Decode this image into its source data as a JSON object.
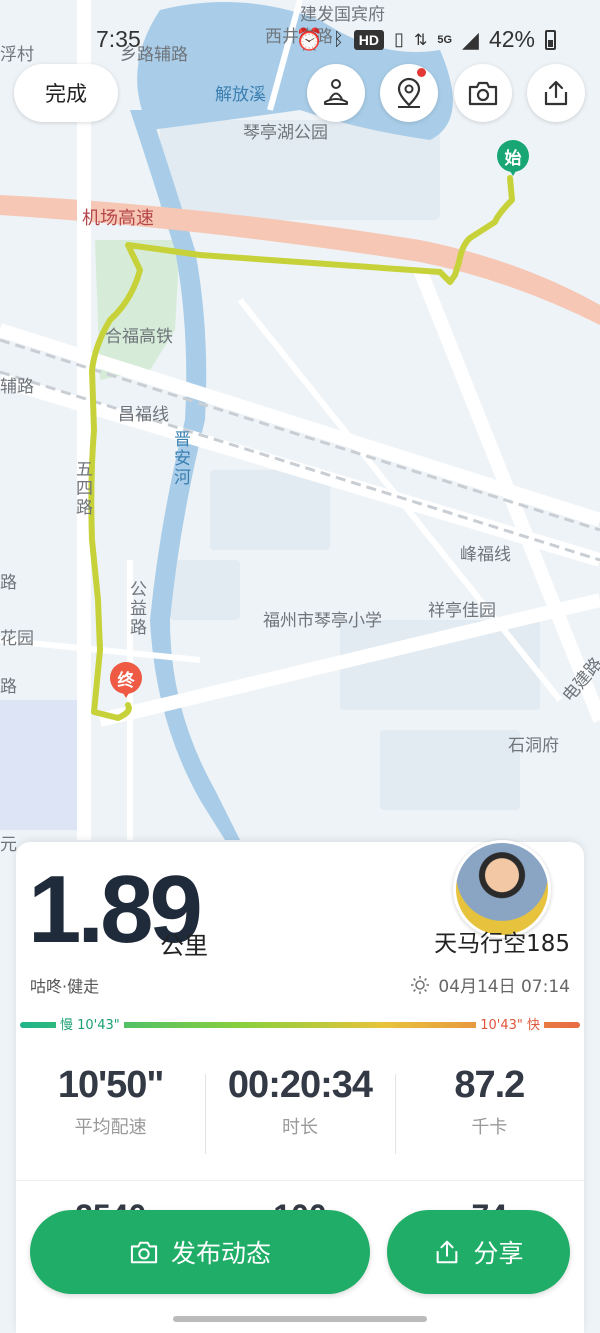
{
  "status_bar": {
    "time": "7:35",
    "hd": "HD",
    "network": "5G",
    "battery": "42%"
  },
  "map": {
    "labels": {
      "top_road_a": "乡路辅路",
      "top_road_b": "西井支路",
      "top_place": "建发国宾府",
      "river": "解放溪",
      "park": "琴亭湖公园",
      "expressway": "机场高速",
      "railway1": "合福高铁",
      "railway2": "昌福线",
      "railway3": "峰福线",
      "river2": "晋安河",
      "road_wusi": "五四路",
      "road_gongyi": "公益路",
      "school": "福州市琴亭小学",
      "estate": "祥亭佳园",
      "road_dianjian": "电建路",
      "shidong": "石洞府",
      "left_road": "辅路",
      "left_garden": "花园",
      "left_fu": "浮村",
      "left_yuan": "元",
      "left_lu1": "路",
      "left_lu2": "路"
    },
    "start_marker": "始",
    "end_marker": "终",
    "route_color": "#c7d23a"
  },
  "toolbar": {
    "done_label": "完成"
  },
  "summary": {
    "distance": "1.89",
    "distance_unit": "公里",
    "username": "天马行空185",
    "activity": "咕咚·健走",
    "datetime": "04月14日 07:14",
    "pace_slow": "慢 10'43\"",
    "pace_fast": "10'43\" 快",
    "stats": [
      {
        "value": "10'50\"",
        "label": "平均配速"
      },
      {
        "value": "00:20:34",
        "label": "时长"
      },
      {
        "value": "87.2",
        "label": "千卡"
      }
    ],
    "stats_row2": [
      "2540",
      "100",
      "74"
    ]
  },
  "actions": {
    "post_label": "发布动态",
    "share_label": "分享"
  },
  "colors": {
    "accent": "#1fad67",
    "brand_dark": "#1f2a3a",
    "pace_slow": "#1fb48a",
    "pace_fast": "#e86a45"
  }
}
